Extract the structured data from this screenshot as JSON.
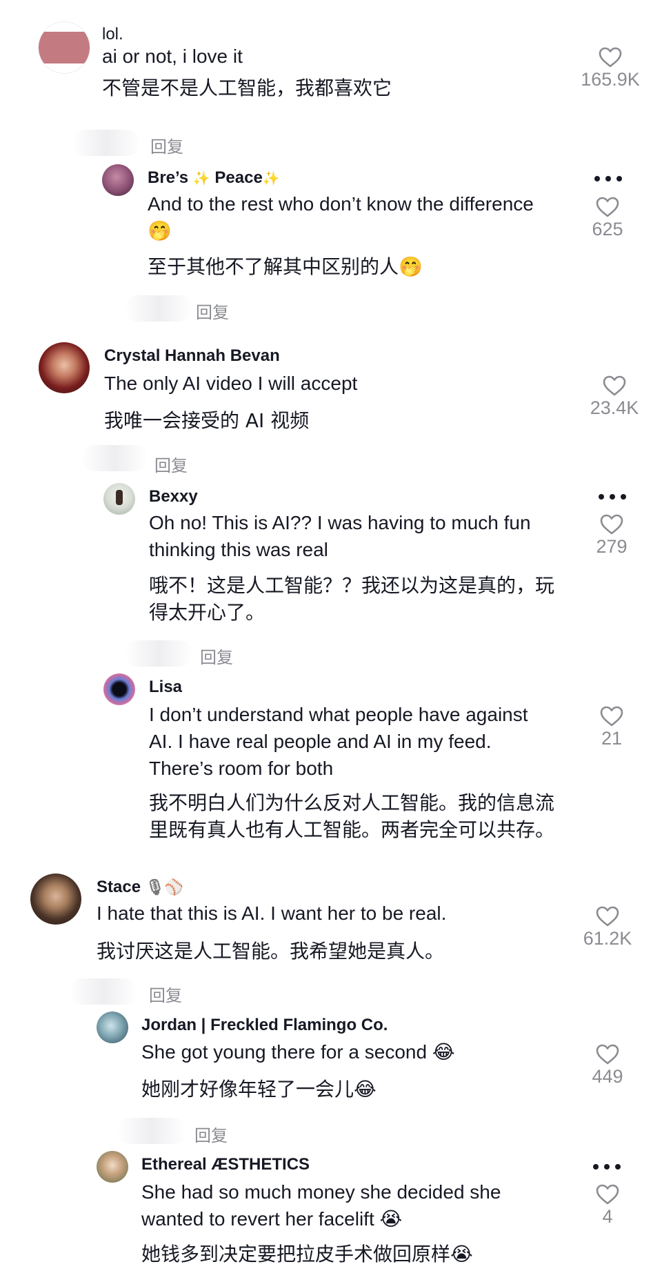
{
  "reply_label": "回复",
  "comments": [
    {
      "user": "lol.",
      "text": "ai or not, i love it",
      "translation": "不管是不是人工智能，我都喜欢它",
      "likes": "165.9K"
    },
    {
      "user": "Bre’s ✨ Peace✨",
      "user_parts": [
        "Bre’s",
        "✨",
        "Peace",
        "✨"
      ],
      "text_lines": [
        "And to the rest who don’t know the difference",
        "🤭"
      ],
      "translation": "至于其他不了解其中区别的人🤭",
      "likes": "625"
    },
    {
      "user": "Crystal Hannah Bevan",
      "text": "The only AI video I will accept",
      "translation": "我唯一会接受的 AI 视频",
      "likes": "23.4K"
    },
    {
      "user": "Bexxy",
      "text_lines": [
        "Oh no! This is AI?? I was having to much fun",
        "thinking this was real"
      ],
      "translation_lines": [
        "哦不！这是人工智能？？我还以为这是真的，玩",
        "得太开心了。"
      ],
      "likes": "279"
    },
    {
      "user": "Lisa",
      "text_lines": [
        "I don’t understand what people have against",
        "AI. I have real people and AI in my feed.",
        "There’s room for both"
      ],
      "translation_lines": [
        "我不明白人们为什么反对人工智能。我的信息流",
        "里既有真人也有人工智能。两者完全可以共存。"
      ],
      "likes": "21"
    },
    {
      "user": "Stace 🎙⚾",
      "user_parts": [
        "Stace",
        "🎙⚾"
      ],
      "text": "I hate that this is AI. I want her to be real.",
      "translation": "我讨厌这是人工智能。我希望她是真人。",
      "likes": "61.2K"
    },
    {
      "user": "Jordan | Freckled Flamingo Co.",
      "text": "She got young there for a second 😂",
      "translation": "她刚才好像年轻了一会儿😂",
      "likes": "449"
    },
    {
      "user": "Ethereal ÆSTHETICS",
      "text_lines": [
        "She had so much money she decided she",
        "wanted to revert her facelift 😭"
      ],
      "translation": "她钱多到决定要把拉皮手术做回原样😭",
      "likes": "4"
    }
  ],
  "colors": {
    "text": "#161823",
    "muted": "#8a8b91",
    "background": "#ffffff"
  },
  "icons": [
    "heart-icon",
    "more-icon"
  ]
}
